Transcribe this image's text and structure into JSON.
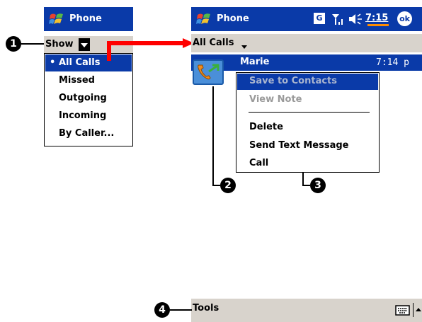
{
  "left_screen": {
    "title": "Phone",
    "menu_label": "Show",
    "dropdown_items": [
      {
        "label": "All Calls",
        "selected": true
      },
      {
        "label": "Missed",
        "selected": false
      },
      {
        "label": "Outgoing",
        "selected": false
      },
      {
        "label": "Incoming",
        "selected": false
      },
      {
        "label": "By Caller...",
        "selected": false
      }
    ],
    "bullet": "•"
  },
  "right_screen": {
    "title": "Phone",
    "status": {
      "network_icon": "G",
      "time": "7:15",
      "ok_label": "ok"
    },
    "menu_label": "All Calls",
    "call_entry": {
      "name": "Marie",
      "time": "7:14 p"
    },
    "context_menu": [
      {
        "label": "Save to Contacts",
        "state": "selected-disabled"
      },
      {
        "label": "View Note",
        "state": "disabled"
      },
      {
        "label": "Delete",
        "state": "normal"
      },
      {
        "label": "Send Text Message",
        "state": "normal"
      },
      {
        "label": "Call",
        "state": "normal"
      }
    ],
    "bottom_menu": "Tools"
  },
  "callouts": [
    "1",
    "2",
    "3",
    "4"
  ],
  "colors": {
    "title_bar": "#0a3aa8",
    "menu_bar": "#d8d3cc",
    "highlight": "#0a3aa8",
    "arrow": "#ff0000"
  }
}
